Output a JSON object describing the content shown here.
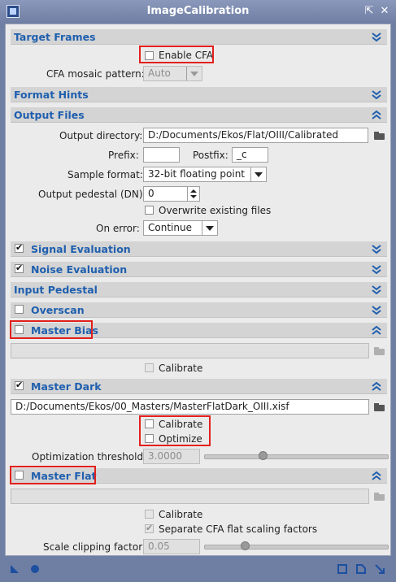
{
  "window": {
    "title": "ImageCalibration",
    "pin_icon": "⇱",
    "shade_icon": "▴",
    "close_icon": "✕"
  },
  "sections": {
    "target_frames": "Target Frames",
    "format_hints": "Format Hints",
    "output_files": "Output Files",
    "signal_evaluation": "Signal Evaluation",
    "noise_evaluation": "Noise Evaluation",
    "input_pedestal": "Input Pedestal",
    "overscan": "Overscan",
    "master_bias": "Master Bias",
    "master_dark": "Master Dark",
    "master_flat": "Master Flat"
  },
  "target": {
    "enable_cfa": "Enable CFA",
    "cfa_mosaic_label": "CFA mosaic pattern:",
    "cfa_mosaic_value": "Auto"
  },
  "output": {
    "directory_label": "Output directory:",
    "directory_value": "D:/Documents/Ekos/Flat/OIII/Calibrated",
    "prefix_label": "Prefix:",
    "prefix_value": "",
    "postfix_label": "Postfix:",
    "postfix_value": "_c",
    "sample_format_label": "Sample format:",
    "sample_format_value": "32-bit floating point",
    "pedestal_label": "Output pedestal (DN):",
    "pedestal_value": "0",
    "overwrite_label": "Overwrite existing files",
    "on_error_label": "On error:",
    "on_error_value": "Continue"
  },
  "master_bias": {
    "path": "",
    "calibrate_label": "Calibrate"
  },
  "master_dark": {
    "path": "D:/Documents/Ekos/00_Masters/MasterFlatDark_OIII.xisf",
    "calibrate_label": "Calibrate",
    "optimize_label": "Optimize",
    "threshold_label": "Optimization threshold:",
    "threshold_value": "3.0000",
    "threshold_level": 0.32
  },
  "master_flat": {
    "path": "",
    "calibrate_label": "Calibrate",
    "separate_cfa_label": "Separate CFA flat scaling factors",
    "scale_clipping_label": "Scale clipping factor:",
    "scale_clipping_value": "0.05",
    "scale_clipping_level": 0.22
  },
  "colors": {
    "section_text": "#1f5fae",
    "highlight": "#e2201c",
    "title_bar": "#7f8db0"
  }
}
